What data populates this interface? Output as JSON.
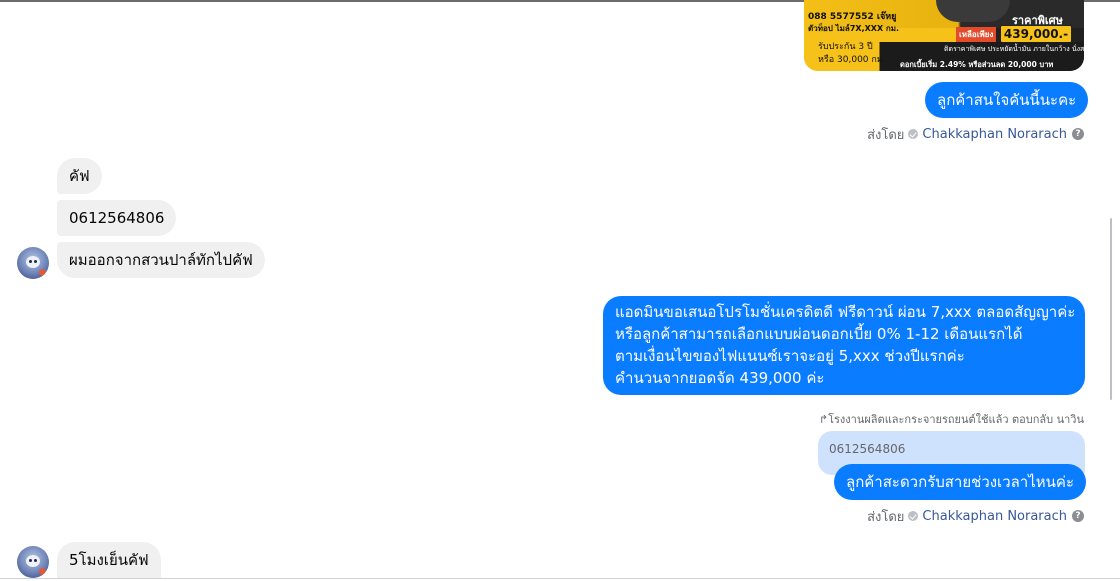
{
  "image_card": {
    "phone": "088 5577552 เจ๊หยู",
    "subtitle": "ตัวท็อป ไมล์7X,XXX กม.",
    "special_label": "ราคาพิเศษ",
    "start_label": "เหลือเพียง",
    "price": "439,000.-",
    "warranty_line1": "รับประกัน 3 ปี",
    "warranty_line2": "หรือ 30,000 กม.",
    "fine_print": "ติดราคาพิเศษ ประหยัดน้ำมัน ภายในกว้าง นั่งสบาย",
    "interest_line": "ดอกเบี้ยเริ่ม 2.49% หรือส่วนลด 20,000 บาท"
  },
  "messages": {
    "out_1": "ลูกค้าสนใจคันนี้นะคะ",
    "in_1": "คัฟ",
    "in_2": "0612564806",
    "in_3": "ผมออกจากสวนปาล์ทักไปคัฟ",
    "out_2_lines": [
      "แอดมินขอเสนอโปรโมชั่นเครดิตดี ฟรีดาวน์  ผ่อน 7,xxx ตลอดสัญญาค่ะ",
      "หรือลูกค้าสามารถเลือกแบบผ่อนดอกเบี้ย 0%  1-12 เดือนแรกได้",
      "ตามเงื่อนไขของไฟแนนซ์เราจะอยู่ 5,xxx ช่วงปีแรกค่ะ",
      "คำนวนจากยอดจัด 439,000 ค่ะ"
    ],
    "reply_label": "โรงงานผลิตและกระจายรถยนต์ใช้แล้ว ตอบกลับ นาวิน",
    "reply_quote": "0612564806",
    "out_3": "ลูกค้าสะดวกรับสายช่วงเวลาไหนค่ะ",
    "in_4": "5โมงเย็นคัฟ"
  },
  "meta": {
    "sent_by_label": "ส่งโดย",
    "sender_name": "Chakkaphan Norarach",
    "help_glyph": "?"
  },
  "icons": {
    "verified": "check-circle-icon",
    "help": "question-circle-icon",
    "reply": "reply-arrow-icon"
  },
  "colors": {
    "outgoing_bubble": "#0a7cff",
    "incoming_bubble": "#f0f0f0",
    "reply_preview": "#cfe2fd",
    "sender_link": "#385898"
  }
}
